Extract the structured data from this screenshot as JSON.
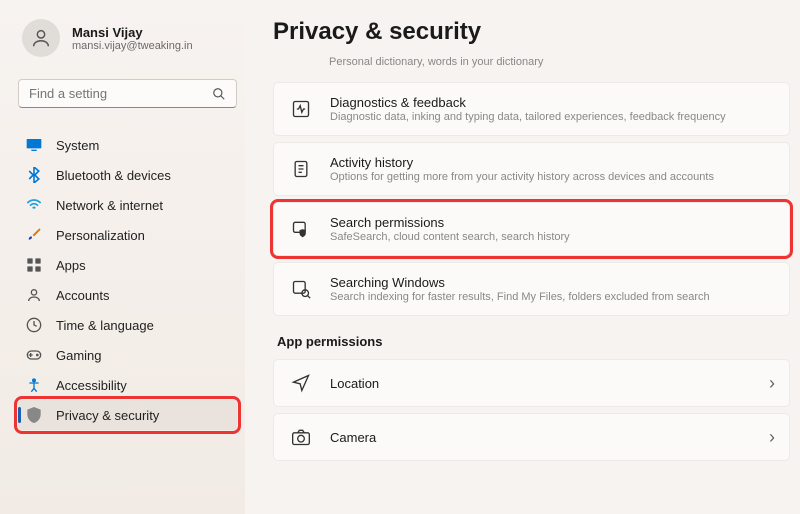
{
  "user": {
    "name": "Mansi Vijay",
    "email": "mansi.vijay@tweaking.in"
  },
  "search": {
    "placeholder": "Find a setting"
  },
  "nav": [
    {
      "label": "System"
    },
    {
      "label": "Bluetooth & devices"
    },
    {
      "label": "Network & internet"
    },
    {
      "label": "Personalization"
    },
    {
      "label": "Apps"
    },
    {
      "label": "Accounts"
    },
    {
      "label": "Time & language"
    },
    {
      "label": "Gaming"
    },
    {
      "label": "Accessibility"
    },
    {
      "label": "Privacy & security"
    }
  ],
  "page": {
    "title": "Privacy & security",
    "partial": "Personal dictionary, words in your dictionary",
    "section": "App permissions"
  },
  "cards": [
    {
      "title": "Diagnostics & feedback",
      "desc": "Diagnostic data, inking and typing data, tailored experiences, feedback frequency"
    },
    {
      "title": "Activity history",
      "desc": "Options for getting more from your activity history across devices and accounts"
    },
    {
      "title": "Search permissions",
      "desc": "SafeSearch, cloud content search, search history"
    },
    {
      "title": "Searching Windows",
      "desc": "Search indexing for faster results, Find My Files, folders excluded from search"
    },
    {
      "title": "Location",
      "desc": ""
    },
    {
      "title": "Camera",
      "desc": ""
    }
  ]
}
